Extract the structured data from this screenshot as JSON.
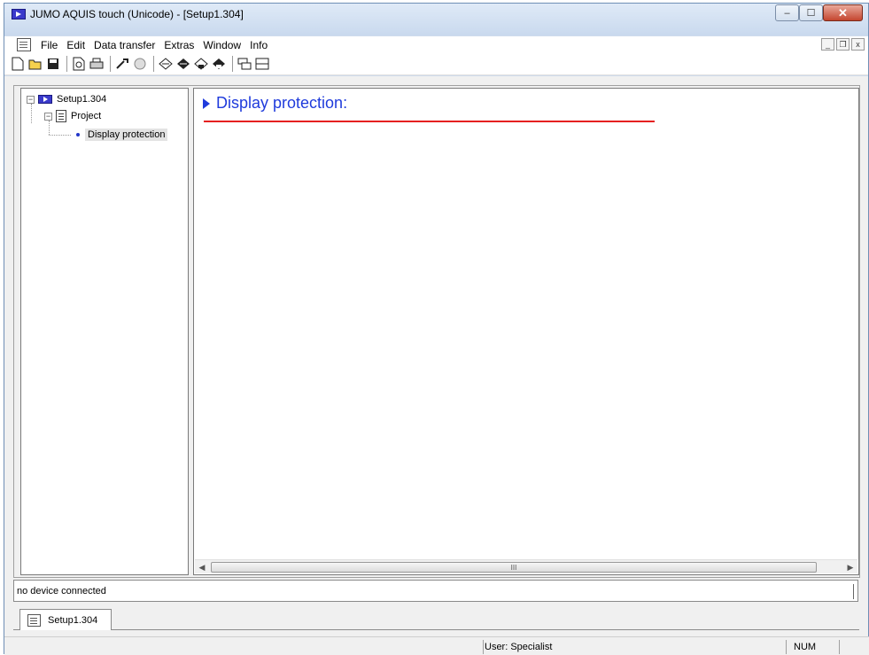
{
  "window": {
    "title": "JUMO AQUIS touch (Unicode) - [Setup1.304]",
    "controls": {
      "minimize": "–",
      "maximize": "☐",
      "close": "✕"
    }
  },
  "menu": {
    "items": [
      "File",
      "Edit",
      "Data transfer",
      "Extras",
      "Window",
      "Info"
    ],
    "mdi_controls": {
      "minimize": "_",
      "restore": "❐",
      "close": "x"
    }
  },
  "toolbar": {
    "icons": [
      "new-icon",
      "open-icon",
      "save-icon",
      "print-preview-icon",
      "print-icon",
      "tool-icon",
      "tool-disabled-icon",
      "arrow-left-icon",
      "arrow-right-icon",
      "transfer-up-icon",
      "transfer-down-icon",
      "window-tile-icon",
      "window-split-icon"
    ]
  },
  "tree": {
    "root": "Setup1.304",
    "project": "Project",
    "item": "Display protection",
    "expander": "−"
  },
  "content": {
    "title": "Display protection:",
    "scroll_grip": "III",
    "scroll_left": "◀",
    "scroll_right": "▶"
  },
  "status": {
    "connection": "no device connected",
    "user": "User: Specialist",
    "num": "NUM"
  },
  "tab": {
    "label": "Setup1.304"
  },
  "colors": {
    "heading_blue": "#1f3bdc",
    "rule_red": "#e52020",
    "app_icon_blue": "#3a3acb"
  }
}
